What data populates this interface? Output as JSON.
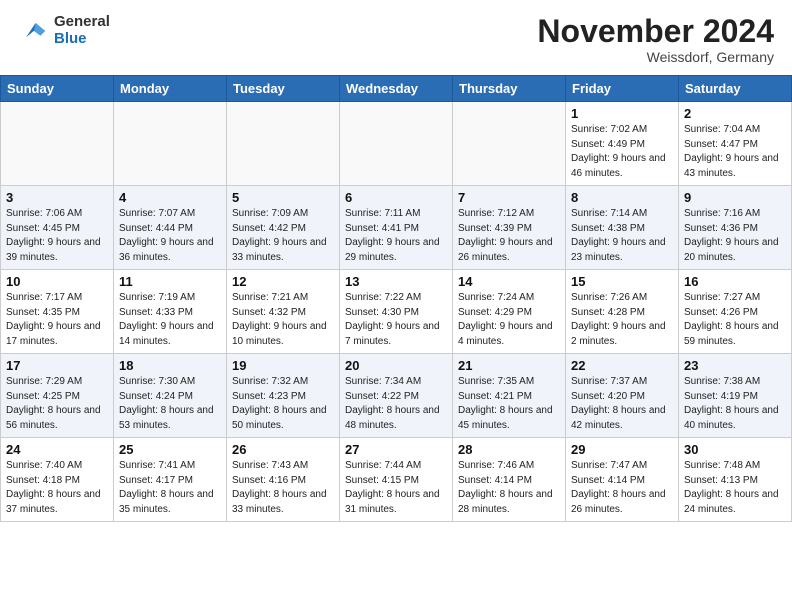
{
  "header": {
    "logo_general": "General",
    "logo_blue": "Blue",
    "month_title": "November 2024",
    "location": "Weissdorf, Germany"
  },
  "days_of_week": [
    "Sunday",
    "Monday",
    "Tuesday",
    "Wednesday",
    "Thursday",
    "Friday",
    "Saturday"
  ],
  "weeks": [
    [
      {
        "day": "",
        "info": ""
      },
      {
        "day": "",
        "info": ""
      },
      {
        "day": "",
        "info": ""
      },
      {
        "day": "",
        "info": ""
      },
      {
        "day": "",
        "info": ""
      },
      {
        "day": "1",
        "info": "Sunrise: 7:02 AM\nSunset: 4:49 PM\nDaylight: 9 hours and 46 minutes."
      },
      {
        "day": "2",
        "info": "Sunrise: 7:04 AM\nSunset: 4:47 PM\nDaylight: 9 hours and 43 minutes."
      }
    ],
    [
      {
        "day": "3",
        "info": "Sunrise: 7:06 AM\nSunset: 4:45 PM\nDaylight: 9 hours and 39 minutes."
      },
      {
        "day": "4",
        "info": "Sunrise: 7:07 AM\nSunset: 4:44 PM\nDaylight: 9 hours and 36 minutes."
      },
      {
        "day": "5",
        "info": "Sunrise: 7:09 AM\nSunset: 4:42 PM\nDaylight: 9 hours and 33 minutes."
      },
      {
        "day": "6",
        "info": "Sunrise: 7:11 AM\nSunset: 4:41 PM\nDaylight: 9 hours and 29 minutes."
      },
      {
        "day": "7",
        "info": "Sunrise: 7:12 AM\nSunset: 4:39 PM\nDaylight: 9 hours and 26 minutes."
      },
      {
        "day": "8",
        "info": "Sunrise: 7:14 AM\nSunset: 4:38 PM\nDaylight: 9 hours and 23 minutes."
      },
      {
        "day": "9",
        "info": "Sunrise: 7:16 AM\nSunset: 4:36 PM\nDaylight: 9 hours and 20 minutes."
      }
    ],
    [
      {
        "day": "10",
        "info": "Sunrise: 7:17 AM\nSunset: 4:35 PM\nDaylight: 9 hours and 17 minutes."
      },
      {
        "day": "11",
        "info": "Sunrise: 7:19 AM\nSunset: 4:33 PM\nDaylight: 9 hours and 14 minutes."
      },
      {
        "day": "12",
        "info": "Sunrise: 7:21 AM\nSunset: 4:32 PM\nDaylight: 9 hours and 10 minutes."
      },
      {
        "day": "13",
        "info": "Sunrise: 7:22 AM\nSunset: 4:30 PM\nDaylight: 9 hours and 7 minutes."
      },
      {
        "day": "14",
        "info": "Sunrise: 7:24 AM\nSunset: 4:29 PM\nDaylight: 9 hours and 4 minutes."
      },
      {
        "day": "15",
        "info": "Sunrise: 7:26 AM\nSunset: 4:28 PM\nDaylight: 9 hours and 2 minutes."
      },
      {
        "day": "16",
        "info": "Sunrise: 7:27 AM\nSunset: 4:26 PM\nDaylight: 8 hours and 59 minutes."
      }
    ],
    [
      {
        "day": "17",
        "info": "Sunrise: 7:29 AM\nSunset: 4:25 PM\nDaylight: 8 hours and 56 minutes."
      },
      {
        "day": "18",
        "info": "Sunrise: 7:30 AM\nSunset: 4:24 PM\nDaylight: 8 hours and 53 minutes."
      },
      {
        "day": "19",
        "info": "Sunrise: 7:32 AM\nSunset: 4:23 PM\nDaylight: 8 hours and 50 minutes."
      },
      {
        "day": "20",
        "info": "Sunrise: 7:34 AM\nSunset: 4:22 PM\nDaylight: 8 hours and 48 minutes."
      },
      {
        "day": "21",
        "info": "Sunrise: 7:35 AM\nSunset: 4:21 PM\nDaylight: 8 hours and 45 minutes."
      },
      {
        "day": "22",
        "info": "Sunrise: 7:37 AM\nSunset: 4:20 PM\nDaylight: 8 hours and 42 minutes."
      },
      {
        "day": "23",
        "info": "Sunrise: 7:38 AM\nSunset: 4:19 PM\nDaylight: 8 hours and 40 minutes."
      }
    ],
    [
      {
        "day": "24",
        "info": "Sunrise: 7:40 AM\nSunset: 4:18 PM\nDaylight: 8 hours and 37 minutes."
      },
      {
        "day": "25",
        "info": "Sunrise: 7:41 AM\nSunset: 4:17 PM\nDaylight: 8 hours and 35 minutes."
      },
      {
        "day": "26",
        "info": "Sunrise: 7:43 AM\nSunset: 4:16 PM\nDaylight: 8 hours and 33 minutes."
      },
      {
        "day": "27",
        "info": "Sunrise: 7:44 AM\nSunset: 4:15 PM\nDaylight: 8 hours and 31 minutes."
      },
      {
        "day": "28",
        "info": "Sunrise: 7:46 AM\nSunset: 4:14 PM\nDaylight: 8 hours and 28 minutes."
      },
      {
        "day": "29",
        "info": "Sunrise: 7:47 AM\nSunset: 4:14 PM\nDaylight: 8 hours and 26 minutes."
      },
      {
        "day": "30",
        "info": "Sunrise: 7:48 AM\nSunset: 4:13 PM\nDaylight: 8 hours and 24 minutes."
      }
    ]
  ]
}
